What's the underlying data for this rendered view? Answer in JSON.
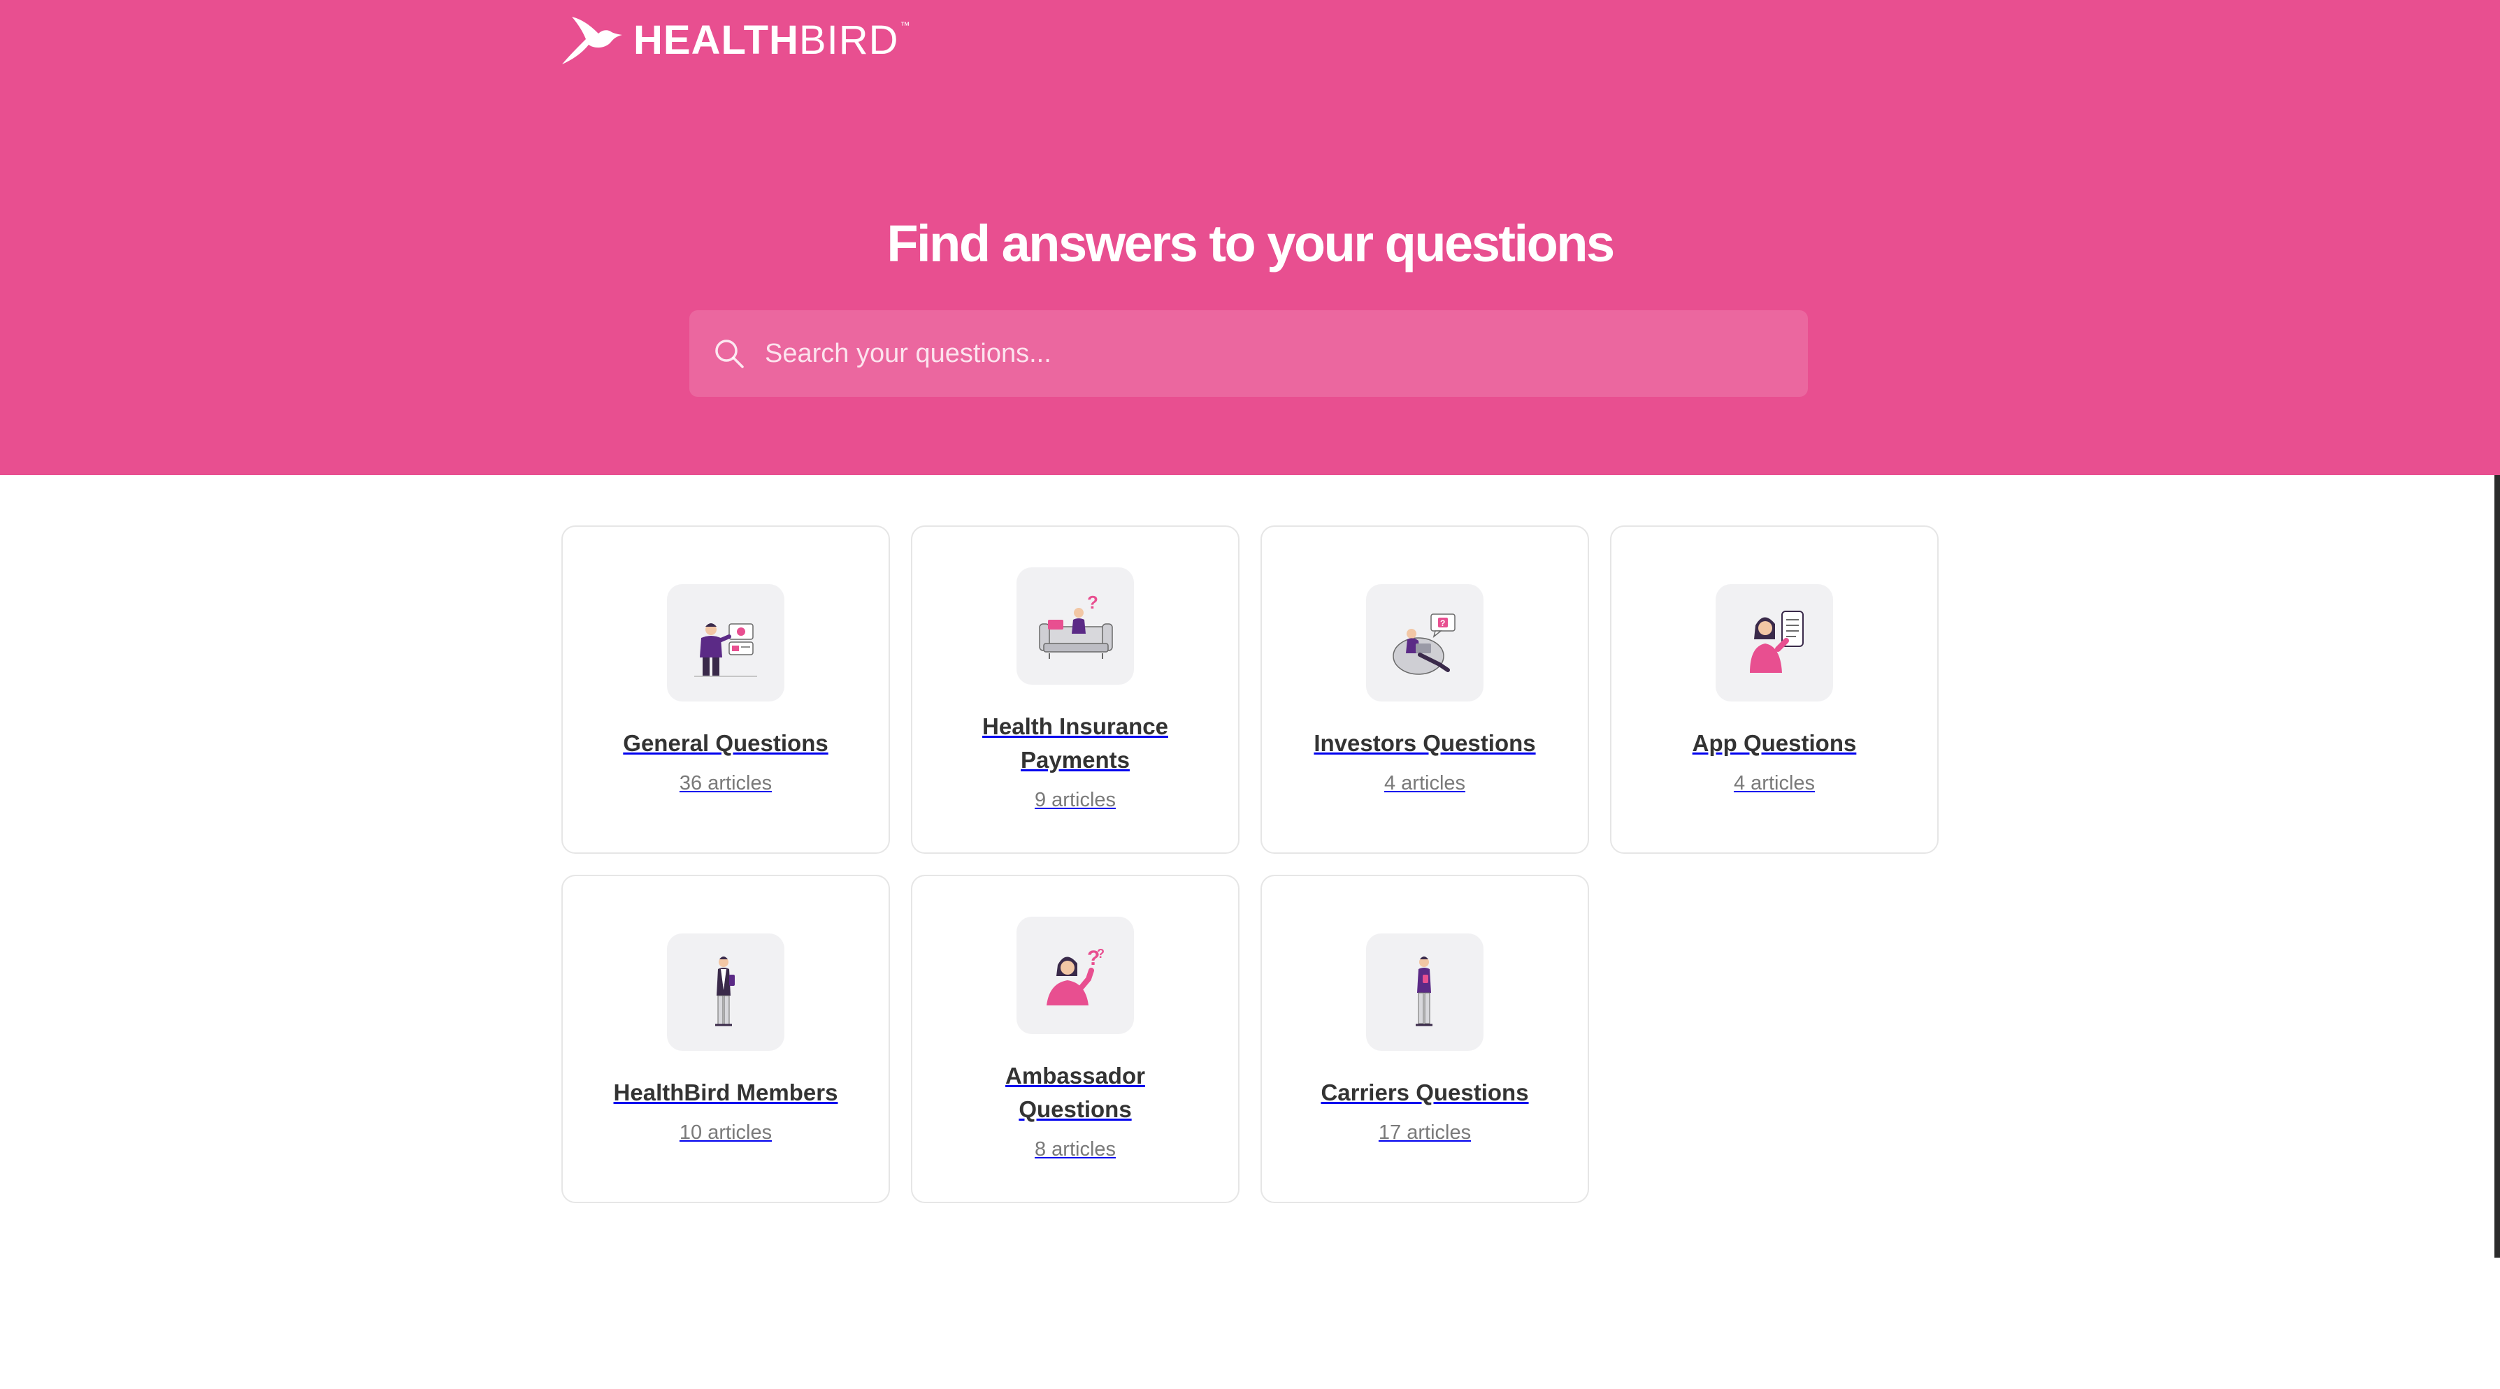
{
  "brand": {
    "name_bold": "HEALTH",
    "name_light": "BIRD",
    "trademark": "™",
    "color": "#e84f90"
  },
  "hero": {
    "title": "Find answers to your questions",
    "search_placeholder": "Search your questions...",
    "search_icon": "search-icon"
  },
  "colors": {
    "accent": "#e84f90",
    "illustration_purple": "#5b2a86",
    "illustration_pink": "#e84f90"
  },
  "collections": [
    {
      "title": "General Questions",
      "count": "36 articles",
      "icon": "person-with-id-cards-illustration"
    },
    {
      "title": "Health Insurance Payments",
      "count": "9 articles",
      "icon": "person-on-sofa-question-illustration"
    },
    {
      "title": "Investors Questions",
      "count": "4 articles",
      "icon": "person-in-beanbag-chat-illustration"
    },
    {
      "title": "App Questions",
      "count": "4 articles",
      "icon": "woman-holding-phone-illustration"
    },
    {
      "title": "HealthBird Members",
      "count": "10 articles",
      "icon": "standing-member-illustration"
    },
    {
      "title": "Ambassador Questions",
      "count": "8 articles",
      "icon": "thinking-woman-question-illustration"
    },
    {
      "title": "Carriers Questions",
      "count": "17 articles",
      "icon": "standing-person-phone-illustration"
    }
  ]
}
